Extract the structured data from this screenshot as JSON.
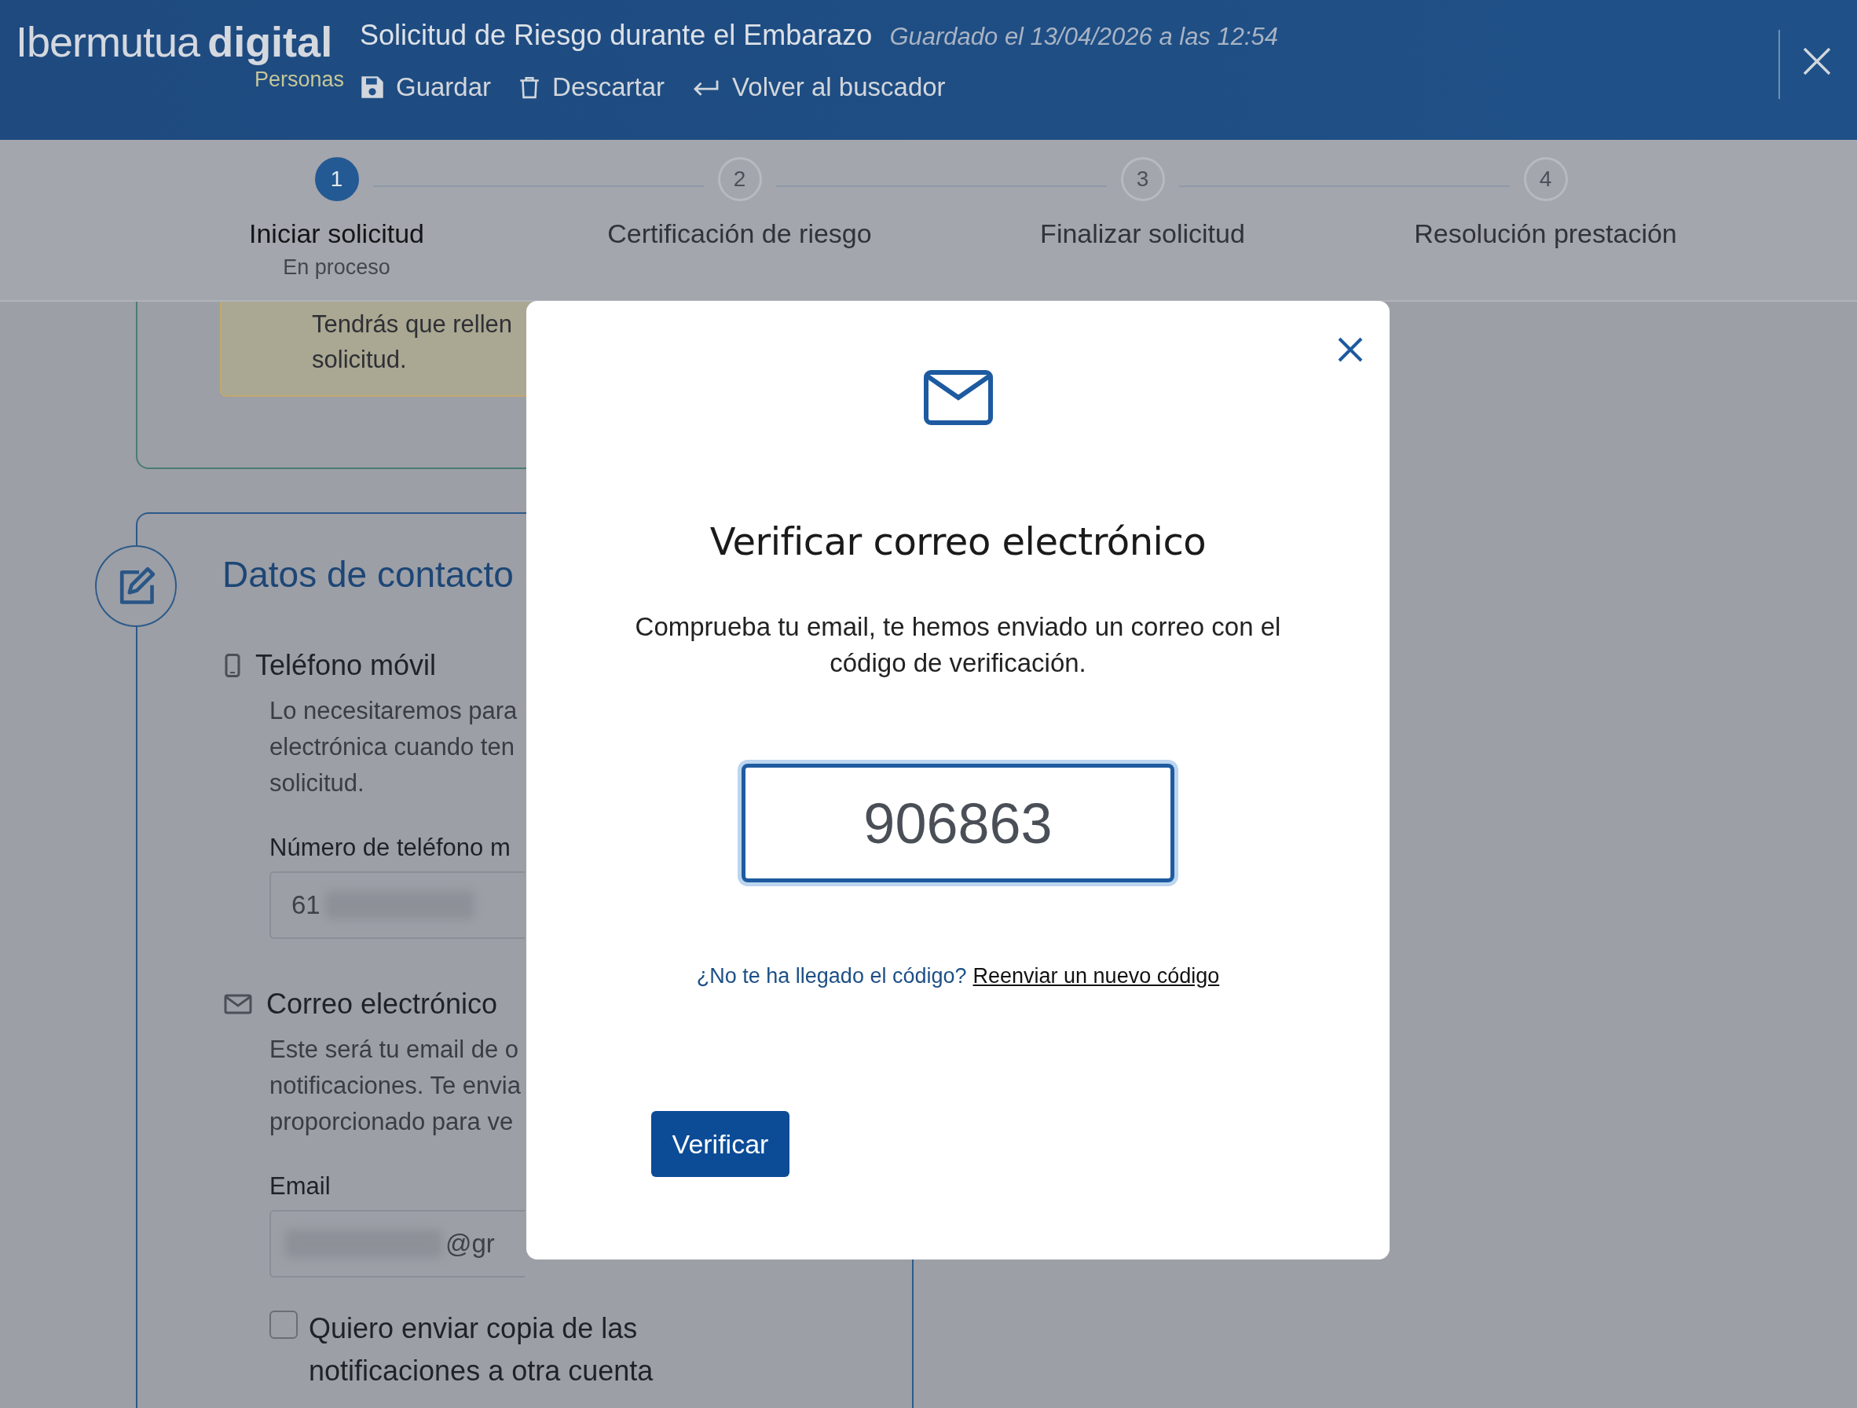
{
  "header": {
    "logo": {
      "brand": "Ibermutua",
      "product": "digital",
      "audience": "Personas"
    },
    "title": "Solicitud de Riesgo durante el Embarazo",
    "saved_status": "Guardado el 13/04/2026 a las 12:54",
    "actions": [
      {
        "kind": "save",
        "label": "Guardar"
      },
      {
        "kind": "discard",
        "label": "Descartar"
      },
      {
        "kind": "back",
        "label": "Volver al buscador"
      }
    ]
  },
  "steps": [
    {
      "number": "1",
      "label": "Iniciar solicitud",
      "status": "En proceso",
      "selected": true
    },
    {
      "number": "2",
      "label": "Certificación de riesgo",
      "selected": false
    },
    {
      "number": "3",
      "label": "Finalizar solicitud",
      "selected": false
    },
    {
      "number": "4",
      "label": "Resolución prestación",
      "selected": false
    }
  ],
  "notice": {
    "lines": [
      "Tendrás que rellen",
      "solicitud."
    ]
  },
  "contact_section": {
    "title": "Datos de contacto",
    "groups": [
      {
        "kind": "phone",
        "title": "Teléfono móvil",
        "description_lines": [
          "Lo necesitaremos para",
          "electrónica cuando ten",
          "solicitud."
        ],
        "field_label": "Número de teléfono m",
        "field_value": "61"
      },
      {
        "kind": "email",
        "title": "Correo electrónico",
        "description_lines": [
          "Este será tu email de o",
          "notificaciones. Te envia",
          "proporcionado para ve"
        ],
        "field_label": "Email",
        "field_value": "@gr"
      }
    ],
    "copy_option": {
      "label": "Quiero enviar copia de las notificaciones a otra cuenta",
      "checked": false
    }
  },
  "modal": {
    "title": "Verificar correo electrónico",
    "message": "Comprueba tu email, te hemos enviado un correo con el código de verificación.",
    "code": "906863",
    "resend_prompt": "¿No te ha llegado el código?",
    "resend_link": "Reenviar un nuevo código",
    "button": "Verificar"
  }
}
